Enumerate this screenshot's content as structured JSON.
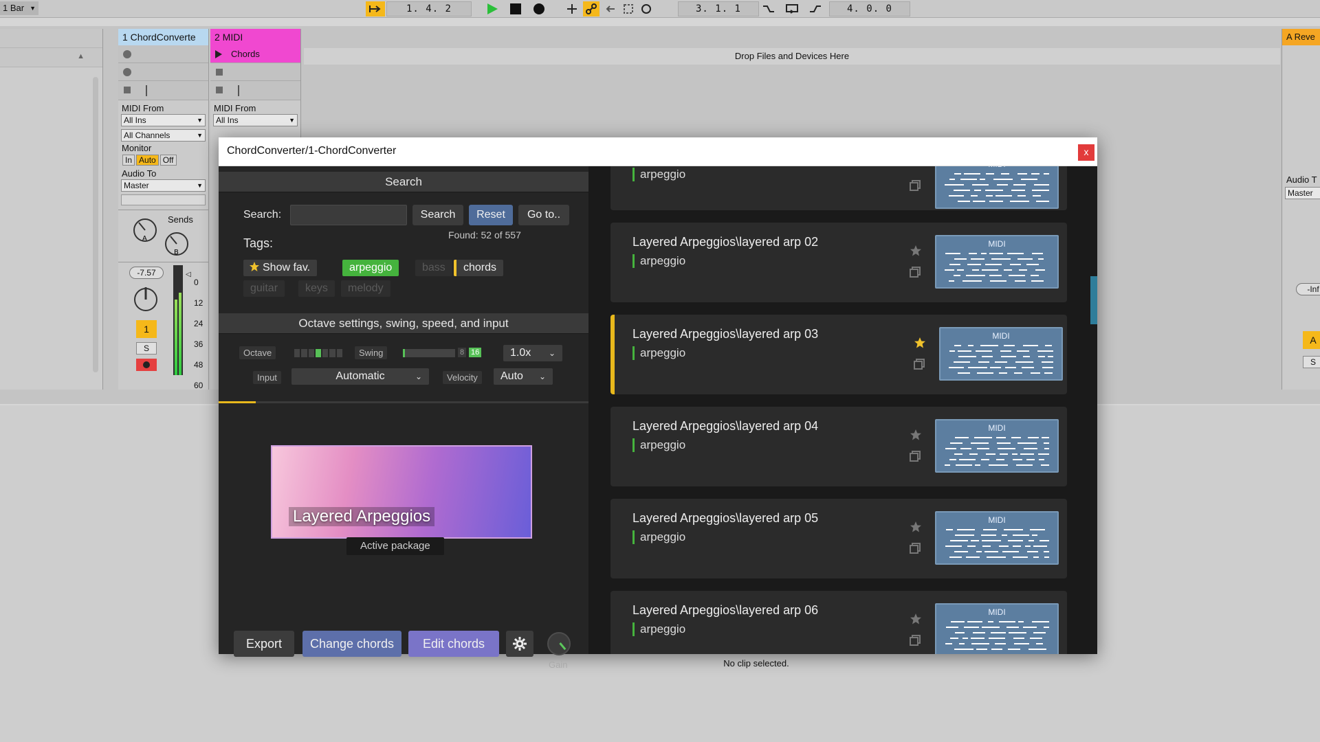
{
  "transport": {
    "quantization": "1 Bar",
    "position": "1.   4.   2",
    "loop_start": "3.   1.   1",
    "loop_length": "4.   0.   0"
  },
  "tracks": [
    {
      "title": "1 ChordConverte",
      "color": "#b8d8f0",
      "midi_from_label": "MIDI From",
      "midi_from": "All Ins",
      "channel": "All Channels",
      "monitor_label": "Monitor",
      "monitor_in": "In",
      "monitor_auto": "Auto",
      "monitor_off": "Off",
      "audio_to_label": "Audio To",
      "audio_to": "Master",
      "sends_label": "Sends",
      "volume": "-7.57",
      "track_num": "1",
      "solo": "S",
      "meter_scale": [
        "0",
        "12",
        "24",
        "36",
        "48",
        "60"
      ]
    },
    {
      "title": "2 MIDI",
      "color": "#f048d0",
      "clip_name": "Chords",
      "midi_from_label": "MIDI From",
      "midi_from": "All Ins"
    }
  ],
  "return_track": {
    "title": "A Reve",
    "audio_to_label": "Audio T",
    "audio_to": "Master",
    "volume": "-Inf",
    "label": "A",
    "solo": "S"
  },
  "drop_zone_text": "Drop Files and Devices Here",
  "status_text": "No clip selected.",
  "plugin": {
    "title": "ChordConverter/1-ChordConverter",
    "close_label": "x",
    "search_section": {
      "heading": "Search",
      "search_label": "Search:",
      "search_value": "",
      "search_button": "Search",
      "reset_button": "Reset",
      "goto_button": "Go to..",
      "found_text": "Found: 52 of 557",
      "tags_label": "Tags:",
      "tags": [
        {
          "label": "Show fav.",
          "state": "normal",
          "icon": "star-icon"
        },
        {
          "label": "arpeggio",
          "state": "active"
        },
        {
          "label": "bass",
          "state": "disabled"
        },
        {
          "label": "chords",
          "state": "highlight"
        },
        {
          "label": "guitar",
          "state": "disabled"
        },
        {
          "label": "keys",
          "state": "disabled"
        },
        {
          "label": "melody",
          "state": "disabled"
        }
      ]
    },
    "settings_section": {
      "heading": "Octave settings, swing, speed, and input",
      "octave_label": "Octave",
      "swing_label": "Swing",
      "swing_options": [
        "8",
        "16"
      ],
      "speed_value": "1.0x",
      "input_label": "Input",
      "input_value": "Automatic",
      "velocity_label": "Velocity",
      "velocity_value": "Auto"
    },
    "package": {
      "name": "Layered Arpeggios",
      "badge": "Active package"
    },
    "bottom_buttons": {
      "export": "Export",
      "change_chords": "Change chords",
      "edit_chords": "Edit chords",
      "gain_label": "Gain"
    },
    "presets": [
      {
        "title": "",
        "tag": "arpeggio",
        "favorite": false,
        "selected": false,
        "thumb_label": "MIDI"
      },
      {
        "title": "Layered Arpeggios\\layered arp 02",
        "tag": "arpeggio",
        "favorite": false,
        "selected": false,
        "thumb_label": "MIDI"
      },
      {
        "title": "Layered Arpeggios\\layered arp 03",
        "tag": "arpeggio",
        "favorite": true,
        "selected": true,
        "thumb_label": "MIDI"
      },
      {
        "title": "Layered Arpeggios\\layered arp 04",
        "tag": "arpeggio",
        "favorite": false,
        "selected": false,
        "thumb_label": "MIDI"
      },
      {
        "title": "Layered Arpeggios\\layered arp 05",
        "tag": "arpeggio",
        "favorite": false,
        "selected": false,
        "thumb_label": "MIDI"
      },
      {
        "title": "Layered Arpeggios\\layered arp 06",
        "tag": "arpeggio",
        "favorite": false,
        "selected": false,
        "thumb_label": "MIDI"
      }
    ]
  }
}
